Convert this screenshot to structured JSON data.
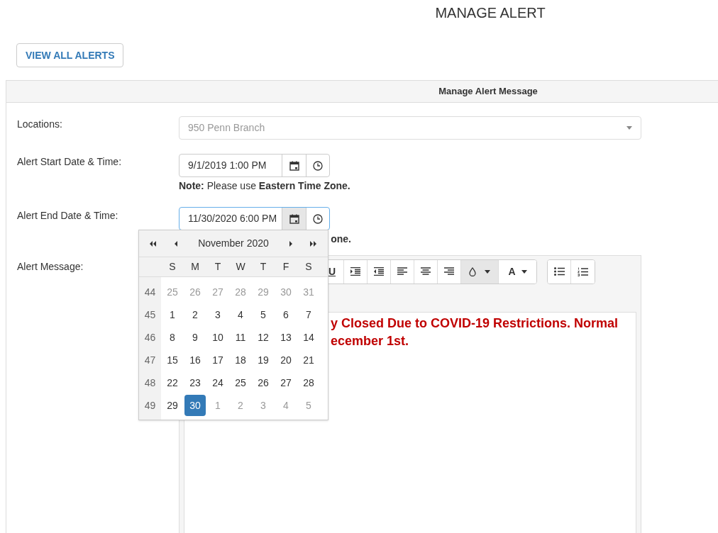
{
  "page_title": "MANAGE ALERT",
  "view_all_button": "VIEW ALL ALERTS",
  "panel": {
    "title": "Manage Alert Message",
    "location": {
      "label": "Locations:",
      "value": "950 Penn Branch",
      "disabled": true
    },
    "start": {
      "label": "Alert Start Date & Time:",
      "value": "9/1/2019 1:00 PM",
      "focused": false,
      "calendar_active": false,
      "note": "**Note:** Please use **Eastern Time Zone.**"
    },
    "end": {
      "label": "Alert End Date & Time:",
      "value": "11/30/2020 6:00 PM",
      "focused": true,
      "calendar_active": true,
      "note_visible": "one."
    },
    "message": {
      "label": "Alert Message:",
      "toolbar": [
        {
          "kind": "underline",
          "label": "U",
          "active": false
        },
        {
          "kind": "indent",
          "active": false
        },
        {
          "kind": "outdent",
          "active": false
        },
        {
          "kind": "align-left",
          "active": false
        },
        {
          "kind": "align-center",
          "active": false
        },
        {
          "kind": "align-right",
          "active": false
        },
        {
          "kind": "color",
          "active": true
        },
        {
          "kind": "font-color",
          "label": "A",
          "active": false
        },
        {
          "kind": "bullet-list",
          "active": false
        },
        {
          "kind": "numbered-list",
          "active": false
        }
      ],
      "lines": [
        "y Closed Due to COVID-19 Restrictions. Normal",
        "ecember 1st."
      ]
    }
  },
  "calendar": {
    "month": "November 2020",
    "weekdays": [
      "S",
      "M",
      "T",
      "W",
      "T",
      "F",
      "S"
    ],
    "weeks": [
      {
        "number": "44",
        "days": [
          {
            "day": "25",
            "muted": true,
            "selected": false
          },
          {
            "day": "26",
            "muted": true,
            "selected": false
          },
          {
            "day": "27",
            "muted": true,
            "selected": false
          },
          {
            "day": "28",
            "muted": true,
            "selected": false
          },
          {
            "day": "29",
            "muted": true,
            "selected": false
          },
          {
            "day": "30",
            "muted": true,
            "selected": false
          },
          {
            "day": "31",
            "muted": true,
            "selected": false
          }
        ]
      },
      {
        "number": "45",
        "days": [
          {
            "day": "1",
            "muted": false,
            "selected": false
          },
          {
            "day": "2",
            "muted": false,
            "selected": false
          },
          {
            "day": "3",
            "muted": false,
            "selected": false
          },
          {
            "day": "4",
            "muted": false,
            "selected": false
          },
          {
            "day": "5",
            "muted": false,
            "selected": false
          },
          {
            "day": "6",
            "muted": false,
            "selected": false
          },
          {
            "day": "7",
            "muted": false,
            "selected": false
          }
        ]
      },
      {
        "number": "46",
        "days": [
          {
            "day": "8",
            "muted": false,
            "selected": false
          },
          {
            "day": "9",
            "muted": false,
            "selected": false
          },
          {
            "day": "10",
            "muted": false,
            "selected": false
          },
          {
            "day": "11",
            "muted": false,
            "selected": false
          },
          {
            "day": "12",
            "muted": false,
            "selected": false
          },
          {
            "day": "13",
            "muted": false,
            "selected": false
          },
          {
            "day": "14",
            "muted": false,
            "selected": false
          }
        ]
      },
      {
        "number": "47",
        "days": [
          {
            "day": "15",
            "muted": false,
            "selected": false
          },
          {
            "day": "16",
            "muted": false,
            "selected": false
          },
          {
            "day": "17",
            "muted": false,
            "selected": false
          },
          {
            "day": "18",
            "muted": false,
            "selected": false
          },
          {
            "day": "19",
            "muted": false,
            "selected": false
          },
          {
            "day": "20",
            "muted": false,
            "selected": false
          },
          {
            "day": "21",
            "muted": false,
            "selected": false
          }
        ]
      },
      {
        "number": "48",
        "days": [
          {
            "day": "22",
            "muted": false,
            "selected": false
          },
          {
            "day": "23",
            "muted": false,
            "selected": false
          },
          {
            "day": "24",
            "muted": false,
            "selected": false
          },
          {
            "day": "25",
            "muted": false,
            "selected": false
          },
          {
            "day": "26",
            "muted": false,
            "selected": false
          },
          {
            "day": "27",
            "muted": false,
            "selected": false
          },
          {
            "day": "28",
            "muted": false,
            "selected": false
          }
        ]
      },
      {
        "number": "49",
        "days": [
          {
            "day": "29",
            "muted": false,
            "selected": false
          },
          {
            "day": "30",
            "muted": false,
            "selected": true
          },
          {
            "day": "1",
            "muted": true,
            "selected": false
          },
          {
            "day": "2",
            "muted": true,
            "selected": false
          },
          {
            "day": "3",
            "muted": true,
            "selected": false
          },
          {
            "day": "4",
            "muted": true,
            "selected": false
          },
          {
            "day": "5",
            "muted": true,
            "selected": false
          }
        ]
      }
    ]
  }
}
